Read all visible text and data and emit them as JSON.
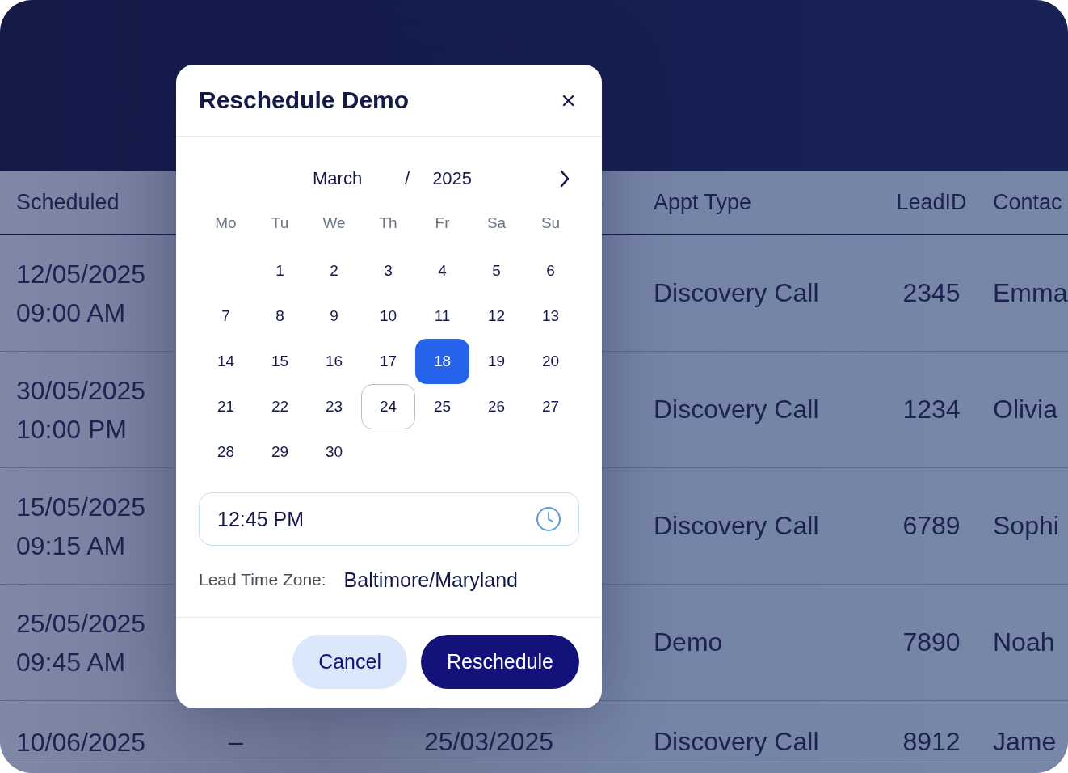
{
  "table": {
    "columns": [
      {
        "label": "Scheduled"
      },
      {
        "label": "Appt Type"
      },
      {
        "label": "LeadID"
      },
      {
        "label": "Contac"
      }
    ],
    "rows": [
      {
        "scheduled": [
          "12/05/2025",
          "09:00 AM"
        ],
        "appt_type": "Discovery Call",
        "lead_id": "2345",
        "contact": "Emma"
      },
      {
        "scheduled": [
          "30/05/2025",
          "10:00 PM"
        ],
        "appt_type": "Discovery Call",
        "lead_id": "1234",
        "contact": "Olivia"
      },
      {
        "scheduled": [
          "15/05/2025",
          "09:15 AM"
        ],
        "appt_type": "Discovery Call",
        "lead_id": "6789",
        "contact": "Sophi"
      },
      {
        "scheduled": [
          "25/05/2025",
          "09:45 AM"
        ],
        "appt_type": "Demo",
        "lead_id": "7890",
        "contact": "Noah"
      },
      {
        "scheduled": [
          "10/06/2025"
        ],
        "column_2": "–",
        "column_3": "25/03/2025",
        "appt_type": "Discovery Call",
        "lead_id": "8912",
        "contact": "Jame"
      }
    ]
  },
  "dialog": {
    "title": "Reschedule Demo",
    "close": "×",
    "month": "March",
    "separator": "/",
    "year": "2025",
    "weekdays": [
      "Mo",
      "Tu",
      "We",
      "Th",
      "Fr",
      "Sa",
      "Su"
    ],
    "weeks": [
      [
        {
          "day": "1",
          "selected": false,
          "today": false
        },
        {
          "day": "2",
          "selected": false,
          "today": false
        },
        {
          "day": "3",
          "selected": false,
          "today": false
        },
        {
          "day": "4",
          "selected": false,
          "today": false
        },
        {
          "day": "5",
          "selected": false,
          "today": false
        },
        {
          "day": "6",
          "selected": false,
          "today": false
        }
      ],
      [
        {
          "day": "7",
          "selected": false,
          "today": false
        },
        {
          "day": "8",
          "selected": false,
          "today": false
        },
        {
          "day": "9",
          "selected": false,
          "today": false
        },
        {
          "day": "10",
          "selected": false,
          "today": false
        },
        {
          "day": "11",
          "selected": false,
          "today": false
        },
        {
          "day": "12",
          "selected": false,
          "today": false
        },
        {
          "day": "13",
          "selected": false,
          "today": false
        }
      ],
      [
        {
          "day": "14",
          "selected": false,
          "today": false
        },
        {
          "day": "15",
          "selected": false,
          "today": false
        },
        {
          "day": "16",
          "selected": false,
          "today": false
        },
        {
          "day": "17",
          "selected": false,
          "today": false
        },
        {
          "day": "18",
          "selected": true,
          "today": false
        },
        {
          "day": "19",
          "selected": false,
          "today": false
        },
        {
          "day": "20",
          "selected": false,
          "today": false
        }
      ],
      [
        {
          "day": "21",
          "selected": false,
          "today": false
        },
        {
          "day": "22",
          "selected": false,
          "today": false
        },
        {
          "day": "23",
          "selected": false,
          "today": false
        },
        {
          "day": "24",
          "selected": false,
          "today": true
        },
        {
          "day": "25",
          "selected": false,
          "today": false
        },
        {
          "day": "26",
          "selected": false,
          "today": false
        },
        {
          "day": "27",
          "selected": false,
          "today": false
        }
      ],
      [
        {
          "day": "28",
          "selected": false,
          "today": false
        },
        {
          "day": "29",
          "selected": false,
          "today": false
        },
        {
          "day": "30",
          "selected": false,
          "today": false
        }
      ]
    ],
    "time": "12:45 PM",
    "timezone_label": "Lead Time Zone:",
    "timezone": "Baltimore/Maryland",
    "buttons": [
      {
        "label": "Cancel",
        "kind": "secondary"
      },
      {
        "label": "Reschedule",
        "kind": "primary"
      }
    ]
  }
}
